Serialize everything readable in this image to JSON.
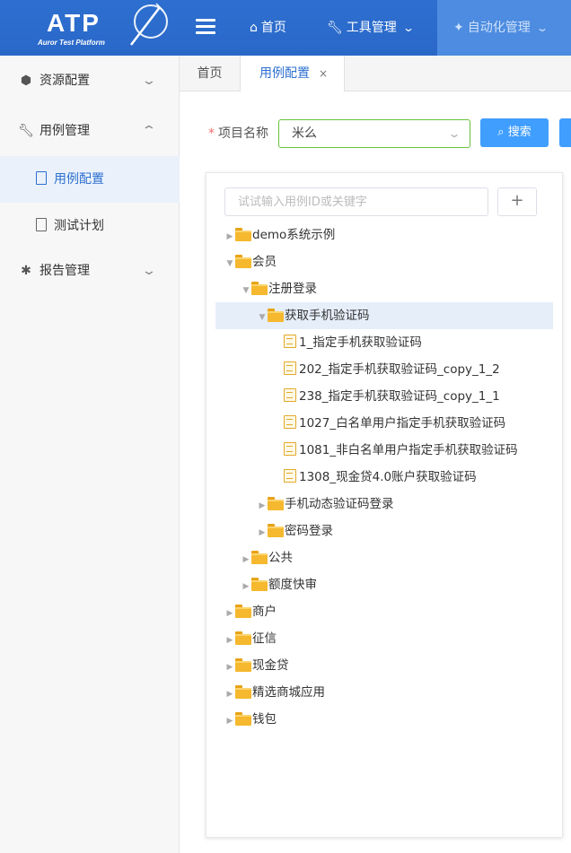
{
  "app": {
    "logo_text": "ATP",
    "logo_subtitle": "Auror Test Platform"
  },
  "topnav": {
    "home": "首页",
    "tools": "工具管理",
    "automation": "自动化管理"
  },
  "sidebar": {
    "resource": "资源配置",
    "case_mgmt": "用例管理",
    "case_config": "用例配置",
    "test_plan": "测试计划",
    "report_mgmt": "报告管理"
  },
  "tabs": {
    "home": "首页",
    "case_config": "用例配置",
    "close": "×"
  },
  "form": {
    "project_label": "项目名称",
    "required_mark": "*",
    "project_value": "米么",
    "search_button": "搜索"
  },
  "tree": {
    "search_placeholder": "试试输入用例ID或关键字",
    "add_button": "+",
    "nodes": [
      {
        "label": "demo系统示例",
        "level": 0,
        "type": "folder",
        "expanded": false
      },
      {
        "label": "会员",
        "level": 0,
        "type": "folder",
        "expanded": true
      },
      {
        "label": "注册登录",
        "level": 1,
        "type": "folder",
        "expanded": true
      },
      {
        "label": "获取手机验证码",
        "level": 2,
        "type": "folder",
        "expanded": true,
        "selected": true
      },
      {
        "label": "1_指定手机获取验证码",
        "level": 3,
        "type": "file"
      },
      {
        "label": "202_指定手机获取验证码_copy_1_2",
        "level": 3,
        "type": "file"
      },
      {
        "label": "238_指定手机获取验证码_copy_1_1",
        "level": 3,
        "type": "file"
      },
      {
        "label": "1027_白名单用户指定手机获取验证码",
        "level": 3,
        "type": "file"
      },
      {
        "label": "1081_非白名单用户指定手机获取验证码",
        "level": 3,
        "type": "file"
      },
      {
        "label": "1308_现金贷4.0账户获取验证码",
        "level": 3,
        "type": "file"
      },
      {
        "label": "手机动态验证码登录",
        "level": 2,
        "type": "folder",
        "expanded": false
      },
      {
        "label": "密码登录",
        "level": 2,
        "type": "folder",
        "expanded": false
      },
      {
        "label": "公共",
        "level": 1,
        "type": "folder",
        "expanded": false
      },
      {
        "label": "额度快审",
        "level": 1,
        "type": "folder",
        "expanded": false
      },
      {
        "label": "商户",
        "level": 0,
        "type": "folder",
        "expanded": false
      },
      {
        "label": "征信",
        "level": 0,
        "type": "folder",
        "expanded": false
      },
      {
        "label": "现金贷",
        "level": 0,
        "type": "folder",
        "expanded": false
      },
      {
        "label": "精选商城应用",
        "level": 0,
        "type": "folder",
        "expanded": false
      },
      {
        "label": "钱包",
        "level": 0,
        "type": "folder",
        "expanded": false
      }
    ]
  }
}
